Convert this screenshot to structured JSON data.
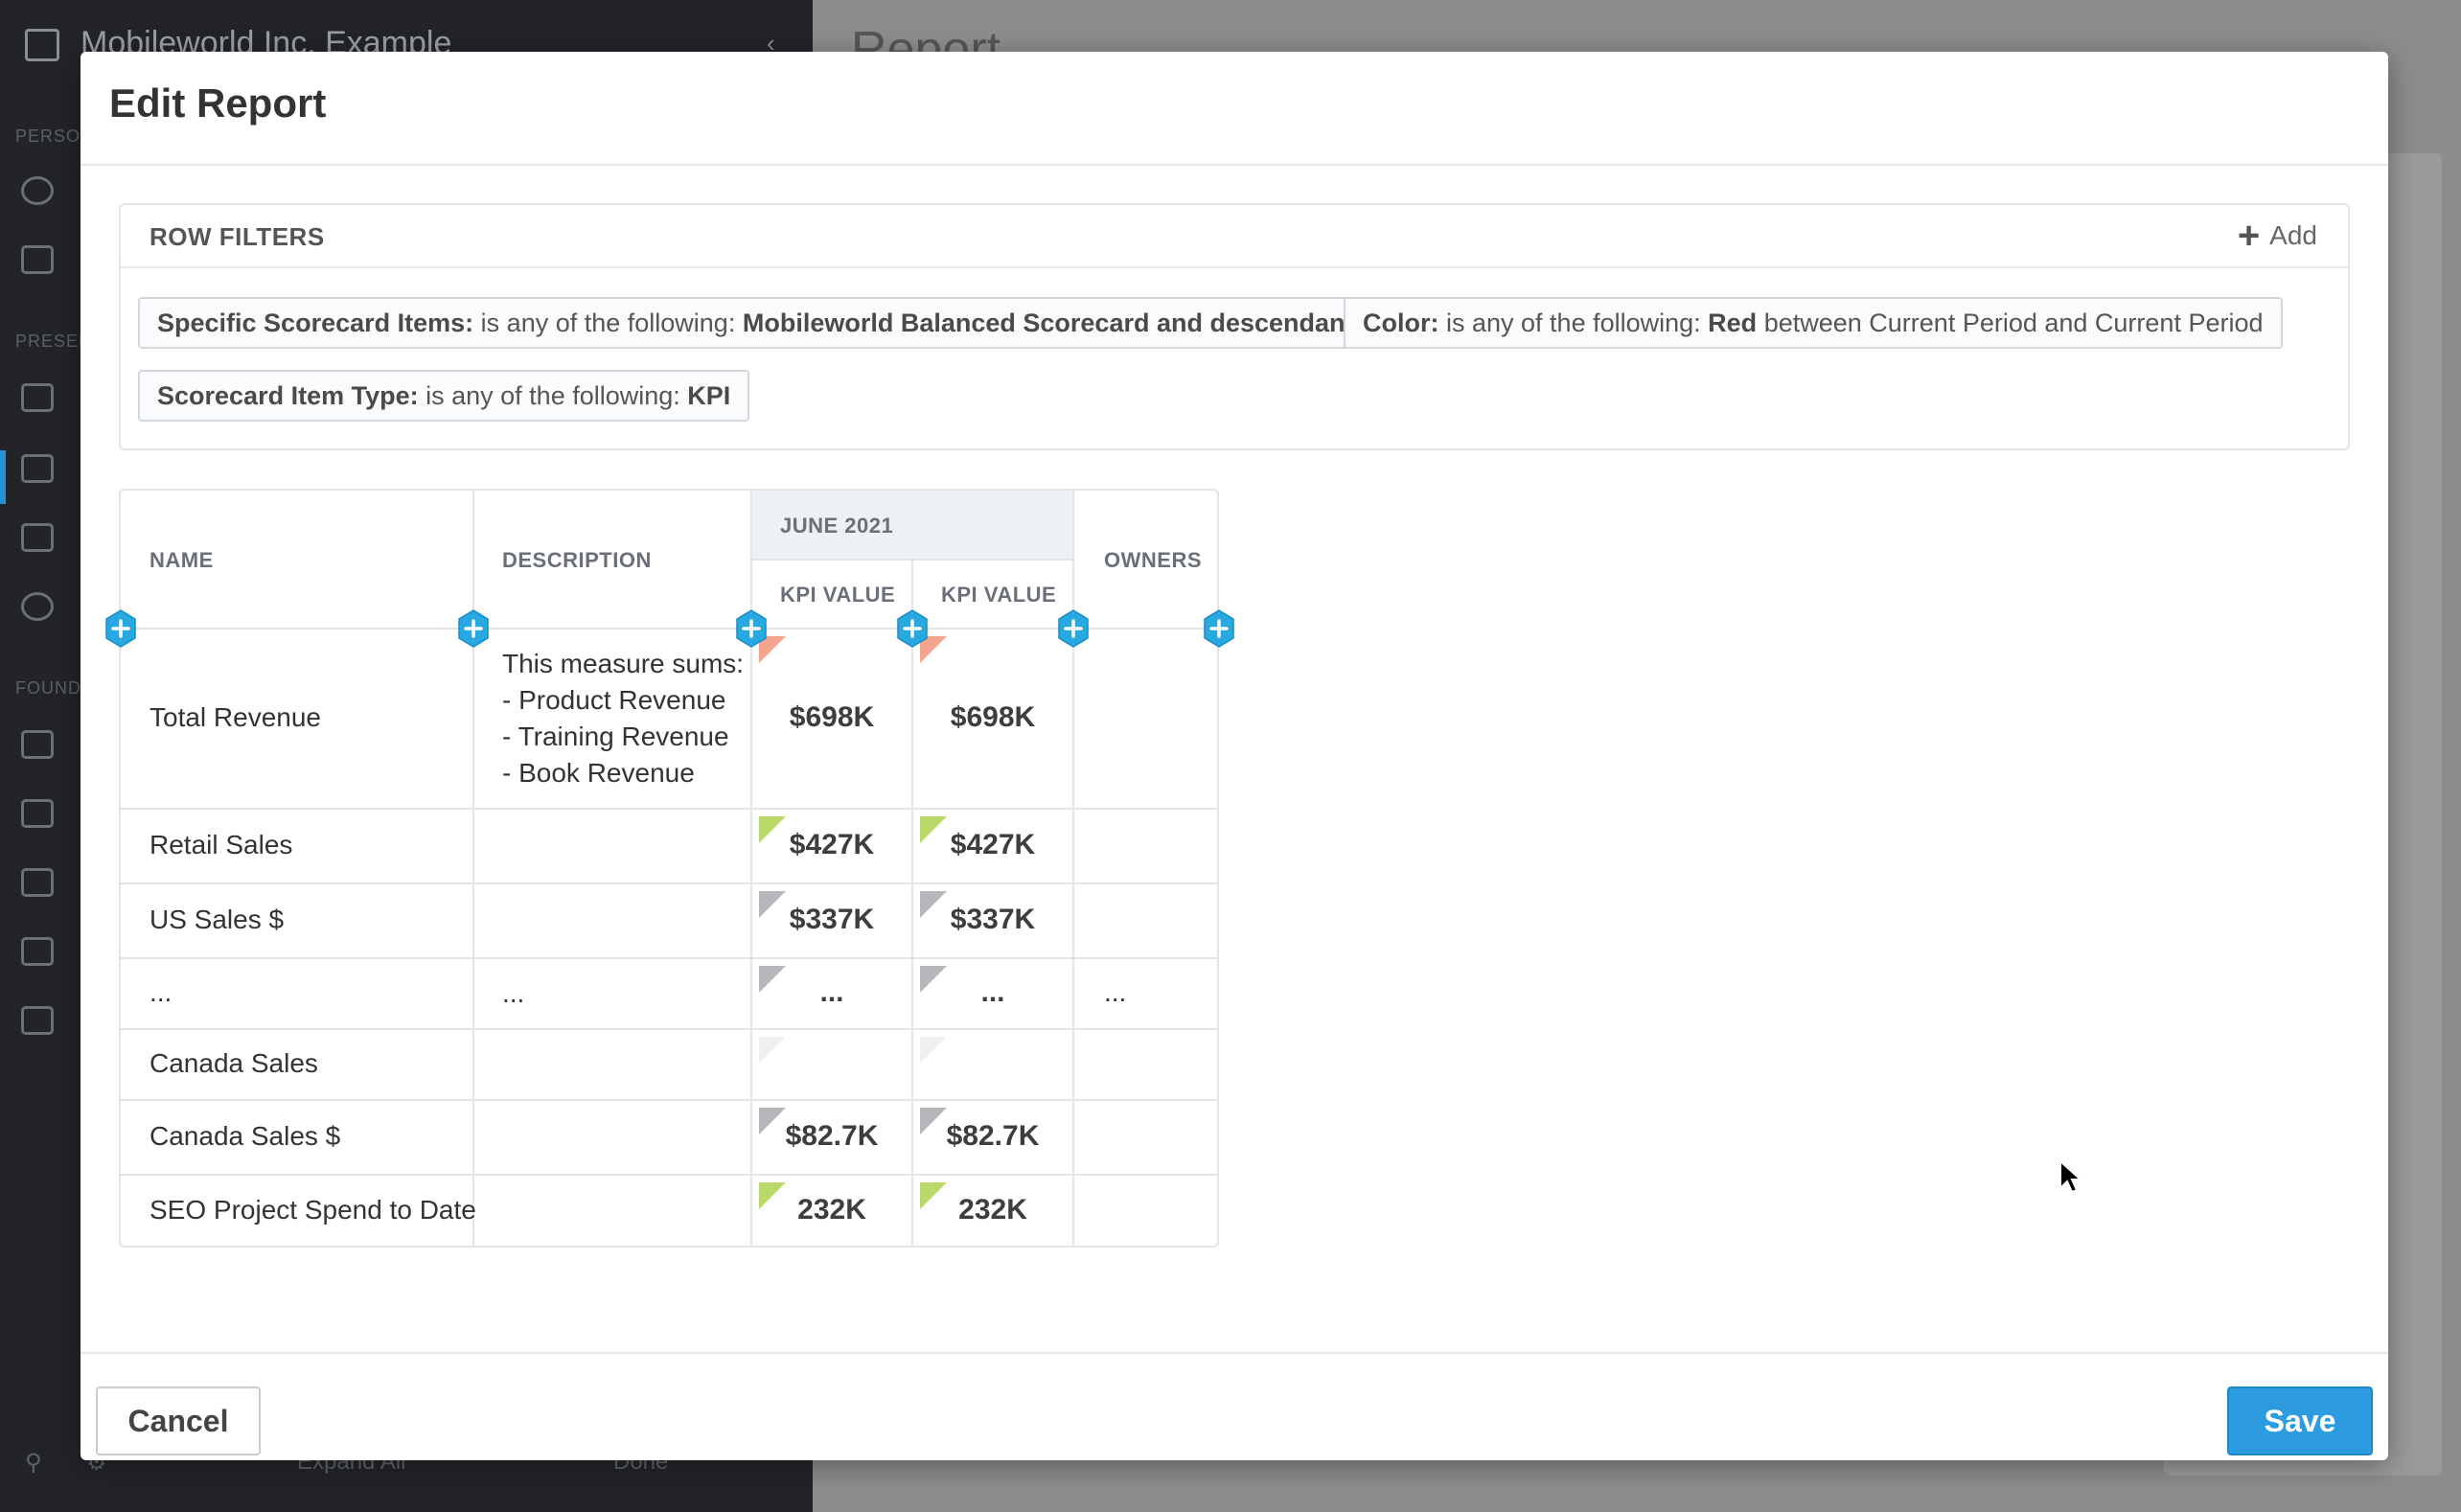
{
  "background": {
    "org_name": "Mobileworld Inc. Example",
    "page_title": "Report",
    "footer_expand": "Expand All",
    "footer_done": "Done"
  },
  "modal": {
    "title": "Edit Report",
    "cancel_label": "Cancel",
    "save_label": "Save"
  },
  "filters": {
    "title": "ROW FILTERS",
    "add_label": "Add",
    "items": [
      {
        "field": "Specific Scorecard Items:",
        "op": "is any of the following:",
        "value": "Mobileworld Balanced Scorecard and descendants",
        "suffix": ""
      },
      {
        "field": "Color:",
        "op": "is any of the following:",
        "value": "Red",
        "suffix": "between Current Period and Current Period"
      },
      {
        "field": "Scorecard Item Type:",
        "op": "is any of the following:",
        "value": "KPI",
        "suffix": ""
      }
    ]
  },
  "table": {
    "headers": {
      "name": "NAME",
      "description": "DESCRIPTION",
      "group": "JUNE 2021",
      "kpi1": "KPI VALUE",
      "kpi2": "KPI VALUE",
      "owners": "OWNERS"
    },
    "rows": [
      {
        "name": "Total Revenue",
        "description": [
          "This measure sums:",
          "- Product Revenue",
          "- Training Revenue",
          "- Book Revenue"
        ],
        "kpi1": "$698K",
        "kpi2": "$698K",
        "owners": "",
        "flag": "#f4a38f"
      },
      {
        "name": "Retail Sales",
        "description": [],
        "kpi1": "$427K",
        "kpi2": "$427K",
        "owners": "",
        "flag": "#b9d96b"
      },
      {
        "name": "US Sales $",
        "description": [],
        "kpi1": "$337K",
        "kpi2": "$337K",
        "owners": "",
        "flag": "#b5b7ba"
      },
      {
        "name": "...",
        "description": [
          "..."
        ],
        "kpi1": "...",
        "kpi2": "...",
        "owners": "...",
        "flag": "#b5b7ba"
      },
      {
        "name": "Canada Sales",
        "description": [],
        "kpi1": "",
        "kpi2": "",
        "owners": "",
        "flag": "#eeeff1"
      },
      {
        "name": "Canada Sales $",
        "description": [],
        "kpi1": "$82.7K",
        "kpi2": "$82.7K",
        "owners": "",
        "flag": "#b5b7ba"
      },
      {
        "name": "SEO Project Spend to Date",
        "description": [],
        "kpi1": "232K",
        "kpi2": "232K",
        "owners": "",
        "flag": "#b9d96b"
      }
    ]
  },
  "colors": {
    "accent": "#2d9be0",
    "add_column_icon": "#29a9e1",
    "red_flag": "#f4a38f",
    "green_flag": "#b9d96b",
    "gray_flag": "#b5b7ba"
  }
}
